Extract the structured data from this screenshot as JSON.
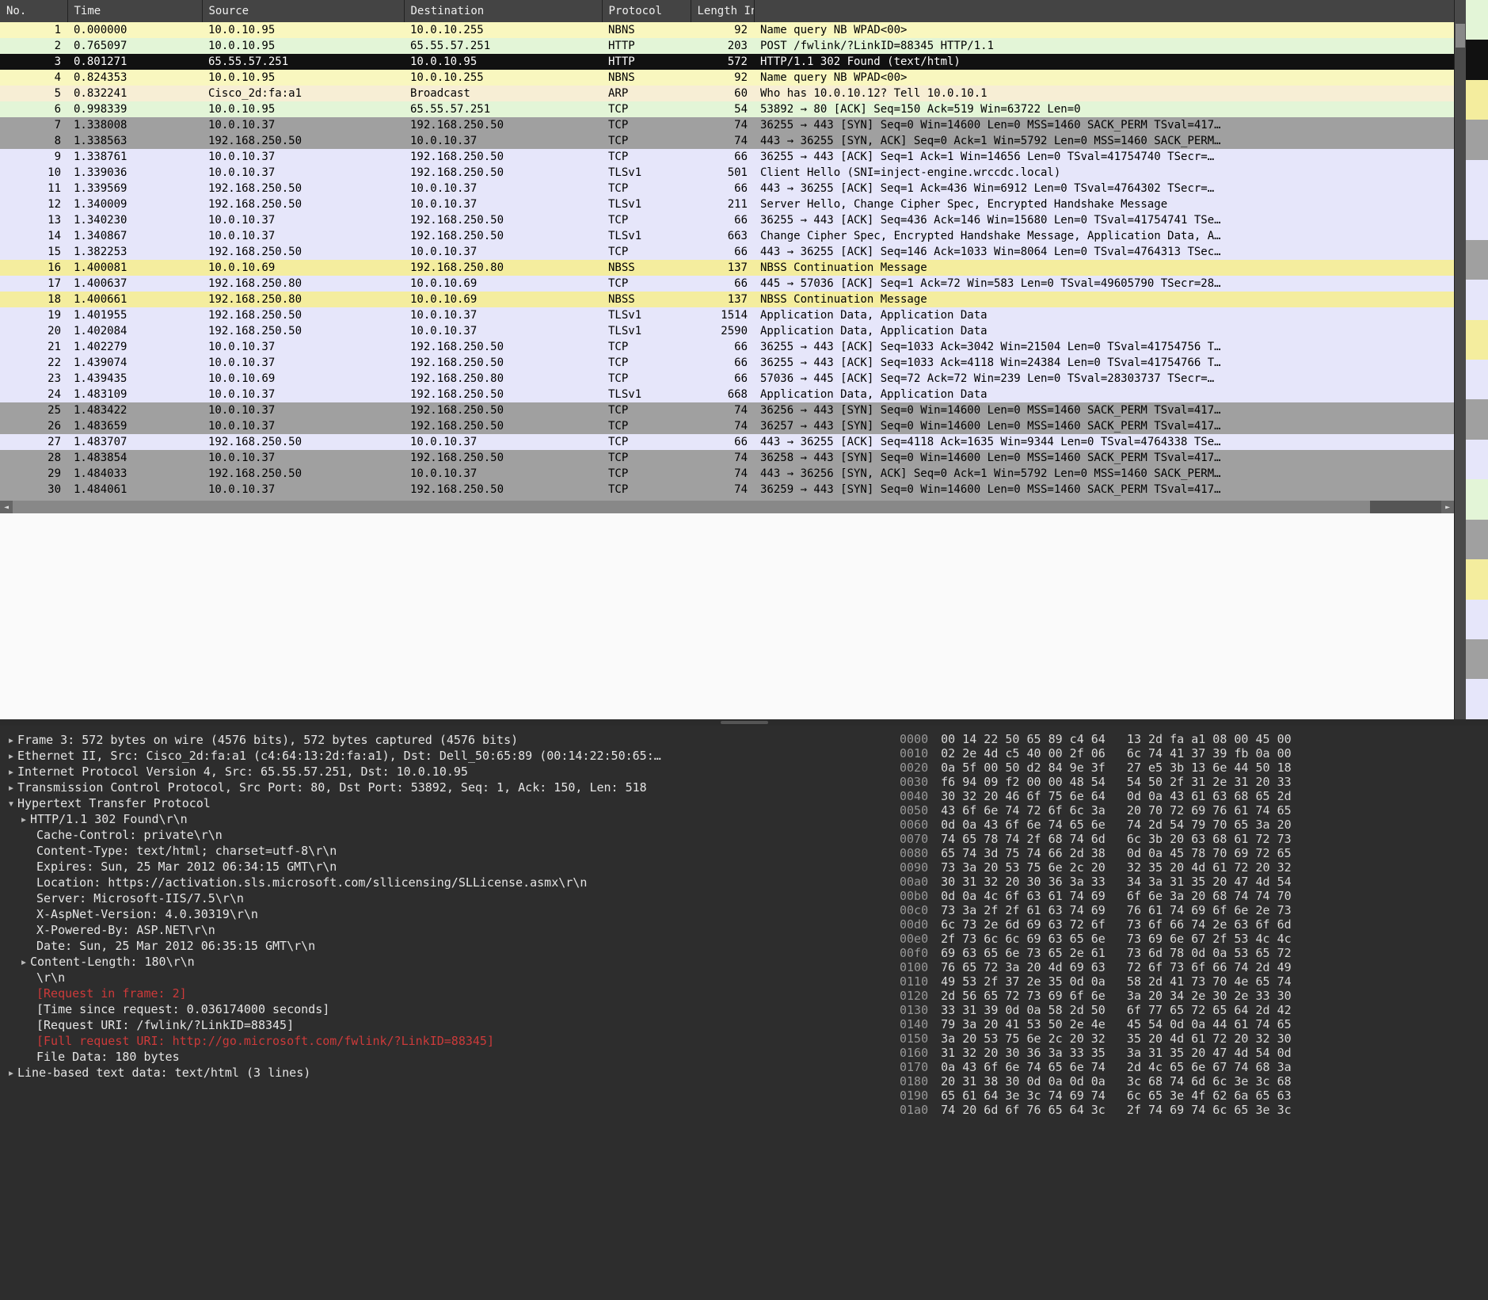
{
  "columns": {
    "no": "No.",
    "time": "Time",
    "source": "Source",
    "destination": "Destination",
    "protocol": "Protocol",
    "length": "Length",
    "info": "Info"
  },
  "packets": [
    {
      "no": 1,
      "time": "0.000000",
      "src": "10.0.10.95",
      "dst": "10.0.10.255",
      "proto": "NBNS",
      "len": 92,
      "info": "Name query NB WPAD<00>",
      "cls": "row-yellow"
    },
    {
      "no": 2,
      "time": "0.765097",
      "src": "10.0.10.95",
      "dst": "65.55.57.251",
      "proto": "HTTP",
      "len": 203,
      "info": "POST /fwlink/?LinkID=88345 HTTP/1.1",
      "cls": "row-green"
    },
    {
      "no": 3,
      "time": "0.801271",
      "src": "65.55.57.251",
      "dst": "10.0.10.95",
      "proto": "HTTP",
      "len": 572,
      "info": "HTTP/1.1 302 Found  (text/html)",
      "cls": "row-selected"
    },
    {
      "no": 4,
      "time": "0.824353",
      "src": "10.0.10.95",
      "dst": "10.0.10.255",
      "proto": "NBNS",
      "len": 92,
      "info": "Name query NB WPAD<00>",
      "cls": "row-yellow"
    },
    {
      "no": 5,
      "time": "0.832241",
      "src": "Cisco_2d:fa:a1",
      "dst": "Broadcast",
      "proto": "ARP",
      "len": 60,
      "info": "Who has 10.0.10.12? Tell 10.0.10.1",
      "cls": "row-orange"
    },
    {
      "no": 6,
      "time": "0.998339",
      "src": "10.0.10.95",
      "dst": "65.55.57.251",
      "proto": "TCP",
      "len": 54,
      "info": "53892 → 80 [ACK] Seq=150 Ack=519 Win=63722 Len=0",
      "cls": "row-green"
    },
    {
      "no": 7,
      "time": "1.338008",
      "src": "10.0.10.37",
      "dst": "192.168.250.50",
      "proto": "TCP",
      "len": 74,
      "info": "36255 → 443 [SYN] Seq=0 Win=14600 Len=0 MSS=1460 SACK_PERM TSval=417…",
      "cls": "row-gray"
    },
    {
      "no": 8,
      "time": "1.338563",
      "src": "192.168.250.50",
      "dst": "10.0.10.37",
      "proto": "TCP",
      "len": 74,
      "info": "443 → 36255 [SYN, ACK] Seq=0 Ack=1 Win=5792 Len=0 MSS=1460 SACK_PERM…",
      "cls": "row-gray"
    },
    {
      "no": 9,
      "time": "1.338761",
      "src": "10.0.10.37",
      "dst": "192.168.250.50",
      "proto": "TCP",
      "len": 66,
      "info": "36255 → 443 [ACK] Seq=1 Ack=1 Win=14656 Len=0 TSval=41754740 TSecr=…",
      "cls": "row-lavender"
    },
    {
      "no": 10,
      "time": "1.339036",
      "src": "10.0.10.37",
      "dst": "192.168.250.50",
      "proto": "TLSv1",
      "len": 501,
      "info": "Client Hello (SNI=inject-engine.wrccdc.local)",
      "cls": "row-lavender"
    },
    {
      "no": 11,
      "time": "1.339569",
      "src": "192.168.250.50",
      "dst": "10.0.10.37",
      "proto": "TCP",
      "len": 66,
      "info": "443 → 36255 [ACK] Seq=1 Ack=436 Win=6912 Len=0 TSval=4764302 TSecr=…",
      "cls": "row-lavender"
    },
    {
      "no": 12,
      "time": "1.340009",
      "src": "192.168.250.50",
      "dst": "10.0.10.37",
      "proto": "TLSv1",
      "len": 211,
      "info": "Server Hello, Change Cipher Spec, Encrypted Handshake Message",
      "cls": "row-lavender"
    },
    {
      "no": 13,
      "time": "1.340230",
      "src": "10.0.10.37",
      "dst": "192.168.250.50",
      "proto": "TCP",
      "len": 66,
      "info": "36255 → 443 [ACK] Seq=436 Ack=146 Win=15680 Len=0 TSval=41754741 TSe…",
      "cls": "row-lavender"
    },
    {
      "no": 14,
      "time": "1.340867",
      "src": "10.0.10.37",
      "dst": "192.168.250.50",
      "proto": "TLSv1",
      "len": 663,
      "info": "Change Cipher Spec, Encrypted Handshake Message, Application Data, A…",
      "cls": "row-lavender"
    },
    {
      "no": 15,
      "time": "1.382253",
      "src": "192.168.250.50",
      "dst": "10.0.10.37",
      "proto": "TCP",
      "len": 66,
      "info": "443 → 36255 [ACK] Seq=146 Ack=1033 Win=8064 Len=0 TSval=4764313 TSec…",
      "cls": "row-lavender"
    },
    {
      "no": 16,
      "time": "1.400081",
      "src": "10.0.10.69",
      "dst": "192.168.250.80",
      "proto": "NBSS",
      "len": 137,
      "info": "NBSS Continuation Message",
      "cls": "row-yellow2"
    },
    {
      "no": 17,
      "time": "1.400637",
      "src": "192.168.250.80",
      "dst": "10.0.10.69",
      "proto": "TCP",
      "len": 66,
      "info": "445 → 57036 [ACK] Seq=1 Ack=72 Win=583 Len=0 TSval=49605790 TSecr=28…",
      "cls": "row-lavender"
    },
    {
      "no": 18,
      "time": "1.400661",
      "src": "192.168.250.80",
      "dst": "10.0.10.69",
      "proto": "NBSS",
      "len": 137,
      "info": "NBSS Continuation Message",
      "cls": "row-yellow2"
    },
    {
      "no": 19,
      "time": "1.401955",
      "src": "192.168.250.50",
      "dst": "10.0.10.37",
      "proto": "TLSv1",
      "len": 1514,
      "info": "Application Data, Application Data",
      "cls": "row-lavender"
    },
    {
      "no": 20,
      "time": "1.402084",
      "src": "192.168.250.50",
      "dst": "10.0.10.37",
      "proto": "TLSv1",
      "len": 2590,
      "info": "Application Data, Application Data",
      "cls": "row-lavender"
    },
    {
      "no": 21,
      "time": "1.402279",
      "src": "10.0.10.37",
      "dst": "192.168.250.50",
      "proto": "TCP",
      "len": 66,
      "info": "36255 → 443 [ACK] Seq=1033 Ack=3042 Win=21504 Len=0 TSval=41754756 T…",
      "cls": "row-lavender"
    },
    {
      "no": 22,
      "time": "1.439074",
      "src": "10.0.10.37",
      "dst": "192.168.250.50",
      "proto": "TCP",
      "len": 66,
      "info": "36255 → 443 [ACK] Seq=1033 Ack=4118 Win=24384 Len=0 TSval=41754766 T…",
      "cls": "row-lavender"
    },
    {
      "no": 23,
      "time": "1.439435",
      "src": "10.0.10.69",
      "dst": "192.168.250.80",
      "proto": "TCP",
      "len": 66,
      "info": "57036 → 445 [ACK] Seq=72 Ack=72 Win=239 Len=0 TSval=28303737 TSecr=…",
      "cls": "row-lavender"
    },
    {
      "no": 24,
      "time": "1.483109",
      "src": "10.0.10.37",
      "dst": "192.168.250.50",
      "proto": "TLSv1",
      "len": 668,
      "info": "Application Data, Application Data",
      "cls": "row-lavender"
    },
    {
      "no": 25,
      "time": "1.483422",
      "src": "10.0.10.37",
      "dst": "192.168.250.50",
      "proto": "TCP",
      "len": 74,
      "info": "36256 → 443 [SYN] Seq=0 Win=14600 Len=0 MSS=1460 SACK_PERM TSval=417…",
      "cls": "row-gray"
    },
    {
      "no": 26,
      "time": "1.483659",
      "src": "10.0.10.37",
      "dst": "192.168.250.50",
      "proto": "TCP",
      "len": 74,
      "info": "36257 → 443 [SYN] Seq=0 Win=14600 Len=0 MSS=1460 SACK_PERM TSval=417…",
      "cls": "row-gray"
    },
    {
      "no": 27,
      "time": "1.483707",
      "src": "192.168.250.50",
      "dst": "10.0.10.37",
      "proto": "TCP",
      "len": 66,
      "info": "443 → 36255 [ACK] Seq=4118 Ack=1635 Win=9344 Len=0 TSval=4764338 TSe…",
      "cls": "row-lavender"
    },
    {
      "no": 28,
      "time": "1.483854",
      "src": "10.0.10.37",
      "dst": "192.168.250.50",
      "proto": "TCP",
      "len": 74,
      "info": "36258 → 443 [SYN] Seq=0 Win=14600 Len=0 MSS=1460 SACK_PERM TSval=417…",
      "cls": "row-gray"
    },
    {
      "no": 29,
      "time": "1.484033",
      "src": "192.168.250.50",
      "dst": "10.0.10.37",
      "proto": "TCP",
      "len": 74,
      "info": "443 → 36256 [SYN, ACK] Seq=0 Ack=1 Win=5792 Len=0 MSS=1460 SACK_PERM…",
      "cls": "row-gray"
    },
    {
      "no": 30,
      "time": "1.484061",
      "src": "10.0.10.37",
      "dst": "192.168.250.50",
      "proto": "TCP",
      "len": 74,
      "info": "36259 → 443 [SYN] Seq=0 Win=14600 Len=0 MSS=1460 SACK_PERM TSval=417…",
      "cls": "row-gray"
    }
  ],
  "truncated": {
    "no": "",
    "time": "",
    "src": "",
    "dst": "",
    "proto": "",
    "len": "",
    "info": ""
  },
  "details": {
    "frame": "Frame 3: 572 bytes on wire (4576 bits), 572 bytes captured (4576 bits)",
    "eth": "Ethernet II, Src: Cisco_2d:fa:a1 (c4:64:13:2d:fa:a1), Dst: Dell_50:65:89 (00:14:22:50:65:…",
    "ip": "Internet Protocol Version 4, Src: 65.55.57.251, Dst: 10.0.10.95",
    "tcp": "Transmission Control Protocol, Src Port: 80, Dst Port: 53892, Seq: 1, Ack: 150, Len: 518",
    "http": "Hypertext Transfer Protocol",
    "status": "HTTP/1.1 302 Found\\r\\n",
    "cache": "Cache-Control: private\\r\\n",
    "ctype": "Content-Type: text/html; charset=utf-8\\r\\n",
    "expires": "Expires: Sun, 25 Mar 2012 06:34:15 GMT\\r\\n",
    "location": "Location: https://activation.sls.microsoft.com/sllicensing/SLLicense.asmx\\r\\n",
    "server": "Server: Microsoft-IIS/7.5\\r\\n",
    "aspnet": "X-AspNet-Version: 4.0.30319\\r\\n",
    "powered": "X-Powered-By: ASP.NET\\r\\n",
    "date": "Date: Sun, 25 Mar 2012 06:35:15 GMT\\r\\n",
    "clen": "Content-Length: 180\\r\\n",
    "crlf": "\\r\\n",
    "reqframe": "[Request in frame: 2]",
    "timesince": "[Time since request: 0.036174000 seconds]",
    "requri": "[Request URI: /fwlink/?LinkID=88345]",
    "fulluri": "[Full request URI: http://go.microsoft.com/fwlink/?LinkID=88345]",
    "filedata": "File Data: 180 bytes",
    "linebased": "Line-based text data: text/html (3 lines)"
  },
  "hex": [
    {
      "off": "0000",
      "b": "00 14 22 50 65 89 c4 64   13 2d fa a1 08 00 45 00"
    },
    {
      "off": "0010",
      "b": "02 2e 4d c5 40 00 2f 06   6c 74 41 37 39 fb 0a 00"
    },
    {
      "off": "0020",
      "b": "0a 5f 00 50 d2 84 9e 3f   27 e5 3b 13 6e 44 50 18"
    },
    {
      "off": "0030",
      "b": "f6 94 09 f2 00 00 48 54   54 50 2f 31 2e 31 20 33"
    },
    {
      "off": "0040",
      "b": "30 32 20 46 6f 75 6e 64   0d 0a 43 61 63 68 65 2d"
    },
    {
      "off": "0050",
      "b": "43 6f 6e 74 72 6f 6c 3a   20 70 72 69 76 61 74 65"
    },
    {
      "off": "0060",
      "b": "0d 0a 43 6f 6e 74 65 6e   74 2d 54 79 70 65 3a 20"
    },
    {
      "off": "0070",
      "b": "74 65 78 74 2f 68 74 6d   6c 3b 20 63 68 61 72 73"
    },
    {
      "off": "0080",
      "b": "65 74 3d 75 74 66 2d 38   0d 0a 45 78 70 69 72 65"
    },
    {
      "off": "0090",
      "b": "73 3a 20 53 75 6e 2c 20   32 35 20 4d 61 72 20 32"
    },
    {
      "off": "00a0",
      "b": "30 31 32 20 30 36 3a 33   34 3a 31 35 20 47 4d 54"
    },
    {
      "off": "00b0",
      "b": "0d 0a 4c 6f 63 61 74 69   6f 6e 3a 20 68 74 74 70"
    },
    {
      "off": "00c0",
      "b": "73 3a 2f 2f 61 63 74 69   76 61 74 69 6f 6e 2e 73"
    },
    {
      "off": "00d0",
      "b": "6c 73 2e 6d 69 63 72 6f   73 6f 66 74 2e 63 6f 6d"
    },
    {
      "off": "00e0",
      "b": "2f 73 6c 6c 69 63 65 6e   73 69 6e 67 2f 53 4c 4c"
    },
    {
      "off": "00f0",
      "b": "69 63 65 6e 73 65 2e 61   73 6d 78 0d 0a 53 65 72"
    },
    {
      "off": "0100",
      "b": "76 65 72 3a 20 4d 69 63   72 6f 73 6f 66 74 2d 49"
    },
    {
      "off": "0110",
      "b": "49 53 2f 37 2e 35 0d 0a   58 2d 41 73 70 4e 65 74"
    },
    {
      "off": "0120",
      "b": "2d 56 65 72 73 69 6f 6e   3a 20 34 2e 30 2e 33 30"
    },
    {
      "off": "0130",
      "b": "33 31 39 0d 0a 58 2d 50   6f 77 65 72 65 64 2d 42"
    },
    {
      "off": "0140",
      "b": "79 3a 20 41 53 50 2e 4e   45 54 0d 0a 44 61 74 65"
    },
    {
      "off": "0150",
      "b": "3a 20 53 75 6e 2c 20 32   35 20 4d 61 72 20 32 30"
    },
    {
      "off": "0160",
      "b": "31 32 20 30 36 3a 33 35   3a 31 35 20 47 4d 54 0d"
    },
    {
      "off": "0170",
      "b": "0a 43 6f 6e 74 65 6e 74   2d 4c 65 6e 67 74 68 3a"
    },
    {
      "off": "0180",
      "b": "20 31 38 30 0d 0a 0d 0a   3c 68 74 6d 6c 3e 3c 68"
    },
    {
      "off": "0190",
      "b": "65 61 64 3e 3c 74 69 74   6c 65 3e 4f 62 6a 65 63"
    },
    {
      "off": "01a0",
      "b": "74 20 6d 6f 76 65 64 3c   2f 74 69 74 6c 65 3e 3c"
    }
  ]
}
